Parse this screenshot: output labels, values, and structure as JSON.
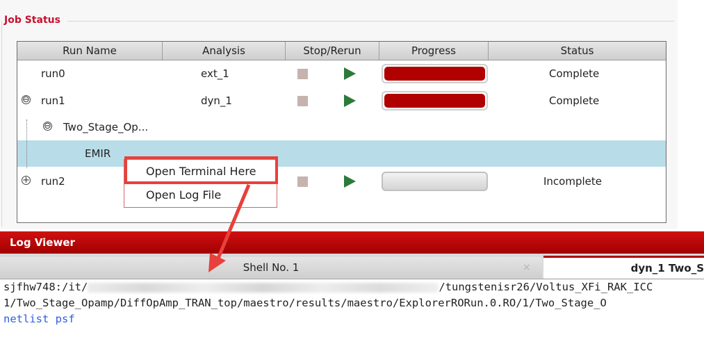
{
  "job_status": {
    "title": "Job Status",
    "columns": [
      "Run Name",
      "Analysis",
      "Stop/Rerun",
      "Progress",
      "Status"
    ],
    "rows": [
      {
        "name": "run0",
        "analysis": "ext_1",
        "progress": 1.0,
        "status": "Complete"
      },
      {
        "name": "run1",
        "analysis": "dyn_1",
        "progress": 1.0,
        "status": "Complete",
        "expander": "⊖"
      },
      {
        "name": "Two_Stage_Op...",
        "expander": "⊖"
      },
      {
        "name": "EMIR"
      },
      {
        "name": "run2",
        "progress": 0.0,
        "status": "Incomplete",
        "expander": "+"
      }
    ]
  },
  "context_menu": {
    "items": [
      "Open Terminal Here",
      "Open Log File"
    ]
  },
  "log_viewer": {
    "title": "Log Viewer",
    "tabs": {
      "shell": "Shell No. 1",
      "close": "×",
      "dyn": "dyn_1 Two_S"
    },
    "terminal": {
      "line1_prefix": "sjfhw748:/it/",
      "line1_suffix": "/tungstenisr26/Voltus_XFi_RAK_ICC",
      "line2": "1/Two_Stage_Opamp/DiffOpAmp_TRAN_top/maestro/results/maestro/ExplorerRORun.0.RO/1/Two_Stage_O",
      "dir1": "netlist",
      "dir2": "psf"
    }
  },
  "colors": {
    "accent": "#c8102e",
    "progress": "#b00000",
    "selected_row": "#b8dde8",
    "annotation": "#e8403a",
    "run_icon": "#2e7a3a"
  }
}
